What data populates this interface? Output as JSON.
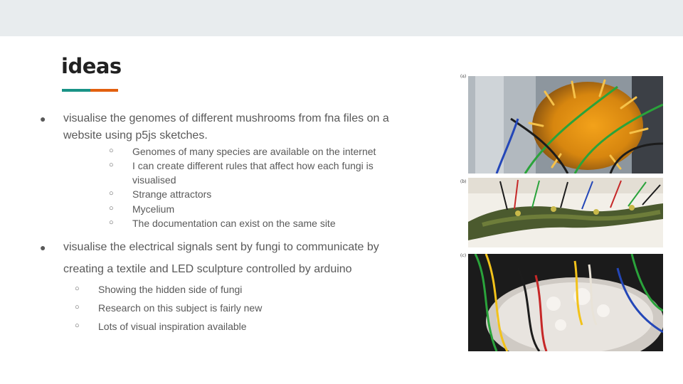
{
  "slide": {
    "title": "ideas",
    "bullets": [
      {
        "marker": "●",
        "text_line1": "visualise the genomes of different mushrooms from fna files on a",
        "text_line2": "website using p5js sketches.",
        "sub_marker": "○",
        "subs": [
          "Genomes of many species are available on the internet",
          "I can create different rules that affect how each fungi is",
          "visualised",
          "Strange attractors",
          "Mycelium",
          "The documentation can exist on the same site"
        ]
      },
      {
        "marker": "●",
        "text_line1": "visualise the electrical signals sent by fungi to communicate by",
        "text_line2": "creating a textile and LED sculpture controlled by arduino",
        "sub_marker": "○",
        "subs": [
          "Showing the hidden side of fungi",
          "Research on this subject is fairly new",
          "Lots of visual inspiration available"
        ]
      }
    ],
    "figure": {
      "panel_labels": [
        "(a)",
        "(b)",
        "(c)"
      ]
    }
  },
  "colors": {
    "top_band": "#e8ecee",
    "accent_teal": "#199386",
    "accent_orange": "#e2600f",
    "body_text": "#595959",
    "title_text": "#212121"
  }
}
